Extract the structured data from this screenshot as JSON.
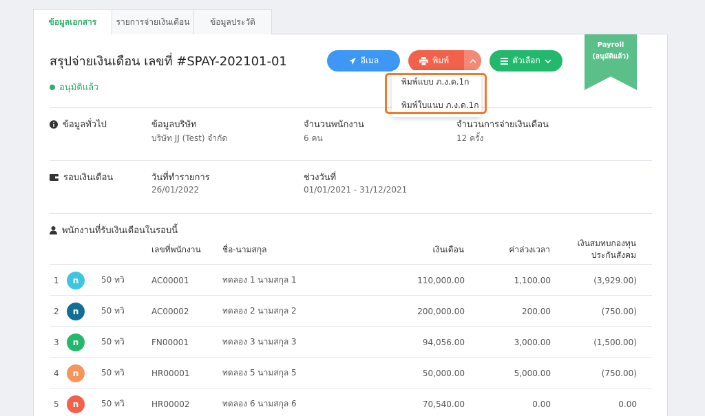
{
  "tabs": [
    {
      "label": "ข้อมูลเอกสาร"
    },
    {
      "label": "รายการจ่ายเงินเดือน"
    },
    {
      "label": "ข้อมูลประวัติ"
    }
  ],
  "header": {
    "title": "สรุปจ่ายเงินเดือน เลขที่ #SPAY-202101-01",
    "status": "อนุมัติแล้ว"
  },
  "toolbar": {
    "email_label": "อีเมล",
    "print_label": "พิมพ์",
    "options_label": "ตัวเลือก"
  },
  "print_menu": {
    "items": [
      {
        "label": "พิมพ์แบบ ภ.ง.ด.1ก"
      },
      {
        "label": "พิมพ์ใบแนบ ภ.ง.ด.1ก"
      }
    ]
  },
  "ribbon": {
    "line1": "Payroll",
    "line2": "(อนุมัติแล้ว)"
  },
  "general": {
    "section_title": "ข้อมูลทั่วไป",
    "company_label": "ข้อมูลบริษัท",
    "company_value": "บริษัท JJ (Test) จำกัด",
    "employees_label": "จำนวนพนักงาน",
    "employees_value": "6 คน",
    "payments_label": "จำนวนการจ่ายเงินเดือน",
    "payments_value": "12 ครั้ง"
  },
  "cycle": {
    "section_title": "รอบเงินเดือน",
    "date_label": "วันที่ทำรายการ",
    "date_value": "26/01/2022",
    "range_label": "ช่วงวันที่",
    "range_value": "01/01/2021 - 31/12/2021"
  },
  "employees": {
    "section_title": "พนักงานที่รับเงินเดือนในรอบนี้",
    "columns": {
      "id": "เลขที่พนักงาน",
      "name": "ชื่อ-นามสกุล",
      "salary": "เงินเดือน",
      "overtime": "ค่าล่วงเวลา",
      "social_line1": "เงินสมทบกองทุน",
      "social_line2": "ประกันสังคม"
    },
    "rows": [
      {
        "no": "1",
        "avatar": "n",
        "color": "#3ec6e0",
        "age": "50 ทวิ",
        "id": "AC00001",
        "name": "ทดลอง 1 นามสกุล 1",
        "salary": "110,000.00",
        "overtime": "1,100.00",
        "social": "(3,929.00)"
      },
      {
        "no": "2",
        "avatar": "n",
        "color": "#136e97",
        "age": "50 ทวิ",
        "id": "AC00002",
        "name": "ทดลอง 2 นามสกุล 2",
        "salary": "200,000.00",
        "overtime": "200.00",
        "social": "(750.00)"
      },
      {
        "no": "3",
        "avatar": "n",
        "color": "#22b96c",
        "age": "50 ทวิ",
        "id": "FN00001",
        "name": "ทดลอง 3 นามสกุล 3",
        "salary": "94,056.00",
        "overtime": "3,000.00",
        "social": "(1,500.00)"
      },
      {
        "no": "4",
        "avatar": "n",
        "color": "#f7945c",
        "age": "50 ทวิ",
        "id": "HR00001",
        "name": "ทดลอง 5 นามสกุล 5",
        "salary": "50,000.00",
        "overtime": "5,000.00",
        "social": "(750.00)"
      },
      {
        "no": "5",
        "avatar": "n",
        "color": "#f2624b",
        "age": "50 ทวิ",
        "id": "HR00002",
        "name": "ทดลอง 6 นามสกุล 6",
        "salary": "70,540.00",
        "overtime": "0.00",
        "social": "0.00"
      }
    ]
  }
}
